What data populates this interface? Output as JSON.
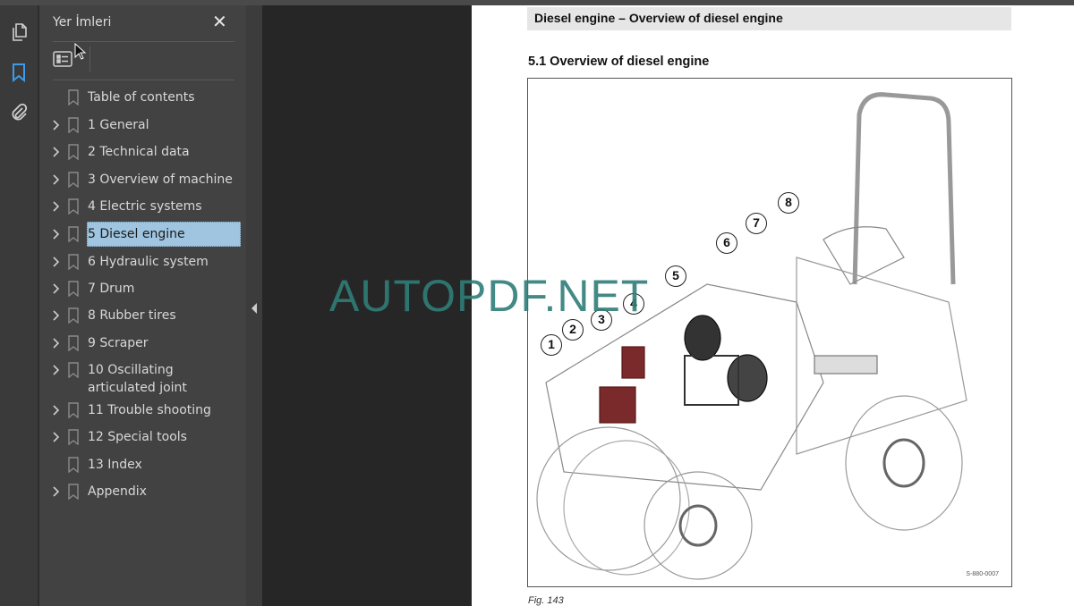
{
  "panel": {
    "title": "Yer İmleri",
    "close_label": "✕"
  },
  "bookmarks": [
    {
      "label": "Table of contents",
      "chevron": false
    },
    {
      "label": "1 General",
      "chevron": true
    },
    {
      "label": "2 Technical data",
      "chevron": true
    },
    {
      "label": "3 Overview of machine",
      "chevron": true
    },
    {
      "label": "4 Electric systems",
      "chevron": true
    },
    {
      "label": "5 Diesel engine",
      "chevron": true,
      "selected": true
    },
    {
      "label": "6 Hydraulic system",
      "chevron": true
    },
    {
      "label": "7 Drum",
      "chevron": true
    },
    {
      "label": "8 Rubber tires",
      "chevron": true
    },
    {
      "label": "9 Scraper",
      "chevron": true
    },
    {
      "label": "10 Oscillating articulated joint",
      "chevron": true
    },
    {
      "label": "11 Trouble shooting",
      "chevron": true
    },
    {
      "label": "12 Special tools",
      "chevron": true
    },
    {
      "label": "13 Index",
      "chevron": false
    },
    {
      "label": "Appendix",
      "chevron": true
    }
  ],
  "document": {
    "header": "Diesel engine – Overview of diesel engine",
    "section": "5.1   Overview of diesel engine",
    "figure_code": "S-880-0007",
    "caption": "Fig.  143",
    "callouts": [
      "1",
      "2",
      "3",
      "4",
      "5",
      "6",
      "7",
      "8"
    ]
  },
  "watermark": "AUTOPDF.NET",
  "colors": {
    "accent": "#3d9be9",
    "selected": "#9fc5e0",
    "watermark": "#2f7d78"
  }
}
